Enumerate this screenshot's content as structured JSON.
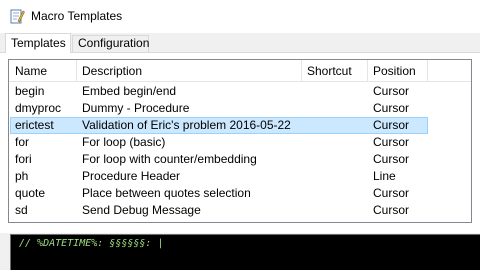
{
  "window": {
    "title": "Macro Templates",
    "icon": "notepad-pencil-icon"
  },
  "tabs": [
    {
      "label": "Templates",
      "active": true
    },
    {
      "label": "Configuration",
      "active": false
    }
  ],
  "table": {
    "columns": [
      "Name",
      "Description",
      "Shortcut",
      "Position"
    ],
    "rows": [
      {
        "name": "begin",
        "description": "Embed begin/end",
        "shortcut": "",
        "position": "Cursor"
      },
      {
        "name": "dmyproc",
        "description": "Dummy - Procedure",
        "shortcut": "",
        "position": "Cursor"
      },
      {
        "name": "erictest",
        "description": "Validation of Eric's problem 2016-05-22",
        "shortcut": "",
        "position": "Cursor",
        "selected": true
      },
      {
        "name": "for",
        "description": "For loop (basic)",
        "shortcut": "",
        "position": "Cursor"
      },
      {
        "name": "fori",
        "description": "For loop with counter/embedding",
        "shortcut": "",
        "position": "Cursor"
      },
      {
        "name": "ph",
        "description": "Procedure Header",
        "shortcut": "",
        "position": "Line"
      },
      {
        "name": "quote",
        "description": "Place between quotes selection",
        "shortcut": "",
        "position": "Cursor"
      },
      {
        "name": "sd",
        "description": "Send Debug Message",
        "shortcut": "",
        "position": "Cursor"
      }
    ]
  },
  "editor": {
    "text": "// %DATETIME%: §§§§§§: |"
  },
  "colors": {
    "selection": "#cce8ff",
    "code_text": "#9cdc7e",
    "editor_bg": "#000000"
  }
}
